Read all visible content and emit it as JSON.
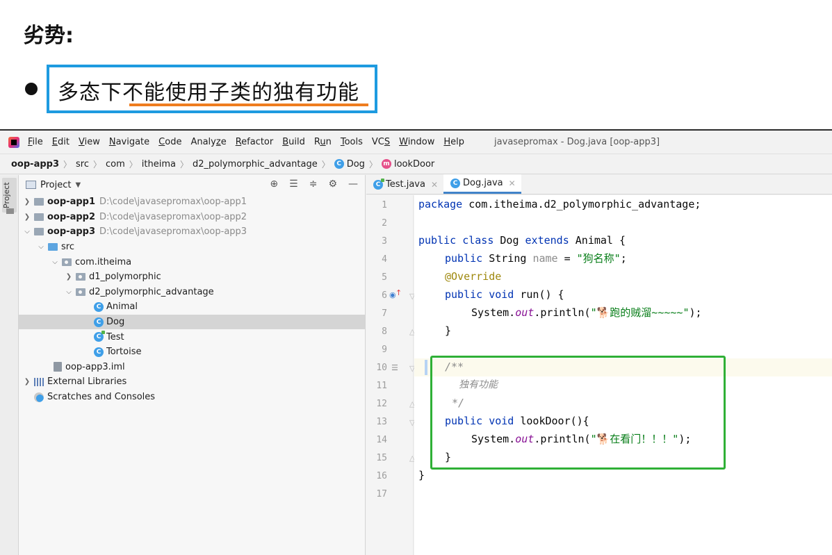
{
  "slide": {
    "heading": "劣势:",
    "bullet": "多态下不能使用子类的独有功能"
  },
  "menu": {
    "items": [
      {
        "key": "F",
        "rest": "ile"
      },
      {
        "key": "E",
        "rest": "dit"
      },
      {
        "key": "V",
        "rest": "iew"
      },
      {
        "key": "N",
        "rest": "avigate"
      },
      {
        "key": "C",
        "rest": "ode"
      },
      {
        "pre": "Analy",
        "key": "z",
        "rest": "e"
      },
      {
        "key": "R",
        "rest": "efactor"
      },
      {
        "key": "B",
        "rest": "uild"
      },
      {
        "pre": "R",
        "key": "u",
        "rest": "n"
      },
      {
        "key": "T",
        "rest": "ools"
      },
      {
        "pre": "VC",
        "key": "S",
        "rest": ""
      },
      {
        "key": "W",
        "rest": "indow"
      },
      {
        "key": "H",
        "rest": "elp"
      }
    ],
    "window_title": "javasepromax - Dog.java [oop-app3]"
  },
  "breadcrumb": {
    "project": "oop-app3",
    "src": "src",
    "com": "com",
    "itheima": "itheima",
    "pkg": "d2_polymorphic_advantage",
    "cls": "Dog",
    "method": "lookDoor",
    "class_icon": "C",
    "method_icon": "m"
  },
  "tool_strip": {
    "label": "Project"
  },
  "project_panel": {
    "title": "Project",
    "tools": [
      "⊕",
      "☰",
      "≑",
      "⚙",
      "—"
    ],
    "tree": [
      {
        "name": "oop-app1",
        "path": "D:\\code\\javasepromax\\oop-app1"
      },
      {
        "name": "oop-app2",
        "path": "D:\\code\\javasepromax\\oop-app2"
      },
      {
        "name": "oop-app3",
        "path": "D:\\code\\javasepromax\\oop-app3"
      },
      {
        "name": "src"
      },
      {
        "name": "com.itheima"
      },
      {
        "name": "d1_polymorphic"
      },
      {
        "name": "d2_polymorphic_advantage"
      },
      {
        "name": "Animal"
      },
      {
        "name": "Dog"
      },
      {
        "name": "Test"
      },
      {
        "name": "Tortoise"
      },
      {
        "name": "oop-app3.iml"
      },
      {
        "name": "External Libraries"
      },
      {
        "name": "Scratches and Consoles"
      }
    ]
  },
  "editor": {
    "tabs": [
      {
        "label": "Test.java"
      },
      {
        "label": "Dog.java"
      }
    ],
    "lines": [
      "1",
      "2",
      "3",
      "4",
      "5",
      "6",
      "7",
      "8",
      "9",
      "10",
      "11",
      "12",
      "13",
      "14",
      "15",
      "16",
      "17"
    ],
    "code": {
      "l1_kw": "package",
      "l1_rest": " com.itheima.d2_polymorphic_advantage;",
      "l3_kw1": "public class",
      "l3_mid": " Dog ",
      "l3_kw2": "extends",
      "l3_rest": " Animal {",
      "l4_kw": "public",
      "l4_type": " String ",
      "l4_var": "name",
      "l4_eq": " = ",
      "l4_str": "\"狗名称\"",
      "l4_end": ";",
      "l5_ann": "@Override",
      "l6_kw": "public void",
      "l6_rest": " run() {",
      "l7_pre": "System.",
      "l7_fld": "out",
      "l7_mid": ".println(",
      "l7_str": "\"🐕跑的贼溜~~~~~\"",
      "l7_end": ");",
      "l8": "}",
      "l10": "/**",
      "l11": "独有功能",
      "l12": "*/",
      "l13_kw": "public void",
      "l13_rest": " lookDoor(){",
      "l14_pre": "System.",
      "l14_fld": "out",
      "l14_mid": ".println(",
      "l14_str": "\"🐕在看门！！！\"",
      "l14_end": ");",
      "l15": "}",
      "l16": "}"
    }
  },
  "colors": {
    "bullet_box": "#1e9be0",
    "underline": "#ef7d1f",
    "highlight_box": "#2fb036",
    "keyword": "#0033b3",
    "string": "#067d17",
    "annotation": "#9e880d"
  }
}
